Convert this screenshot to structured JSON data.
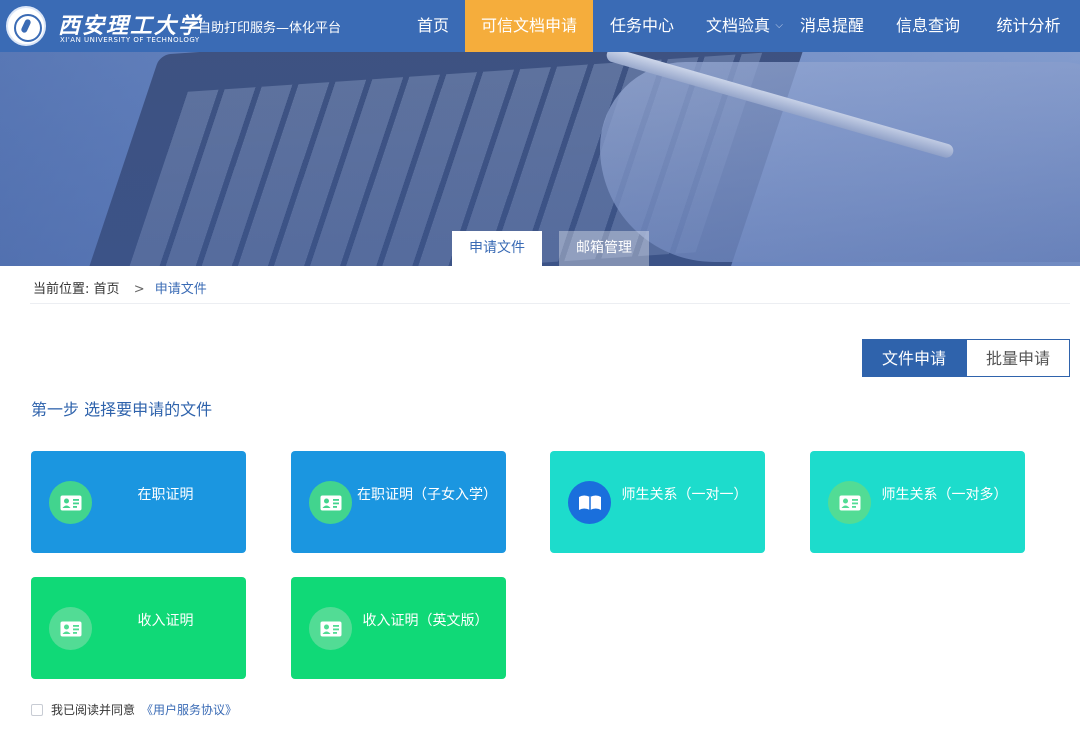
{
  "header": {
    "brand_cn": "西安理工大学",
    "brand_en": "XI'AN UNIVERSITY OF TECHNOLOGY",
    "platform_title": "自助打印服务—体化平台",
    "nav": [
      {
        "label": "首页"
      },
      {
        "label": "可信文档申请",
        "active": true
      },
      {
        "label": "任务中心"
      },
      {
        "label": "文档验真"
      },
      {
        "label": "消息提醒"
      },
      {
        "label": "信息查询"
      },
      {
        "label": "统计分析"
      }
    ],
    "active_color": "#f5ad3c",
    "bar_color": "#3a6bb5"
  },
  "banner_tabs": [
    {
      "label": "申请文件",
      "active": true
    },
    {
      "label": "邮箱管理"
    }
  ],
  "breadcrumb": {
    "prefix": "当前位置:",
    "home": "首页",
    "separator": ">",
    "current": "申请文件"
  },
  "mode_buttons": [
    {
      "label": "文件申请",
      "active": true
    },
    {
      "label": "批量申请"
    }
  ],
  "step_title": "第一步 选择要申请的文件",
  "cards": [
    {
      "label": "在职证明",
      "icon": "id-card-icon"
    },
    {
      "label": "在职证明（子女入学）",
      "icon": "id-card-icon"
    },
    {
      "label": "师生关系（一对一）",
      "icon": "book-icon"
    },
    {
      "label": "师生关系（一对多）",
      "icon": "id-card-icon"
    },
    {
      "label": "收入证明",
      "icon": "id-card-icon"
    },
    {
      "label": "收入证明（英文版）",
      "icon": "id-card-icon"
    }
  ],
  "agreement": {
    "text": "我已阅读并同意",
    "link": "《用户服务协议》",
    "checked": false
  }
}
